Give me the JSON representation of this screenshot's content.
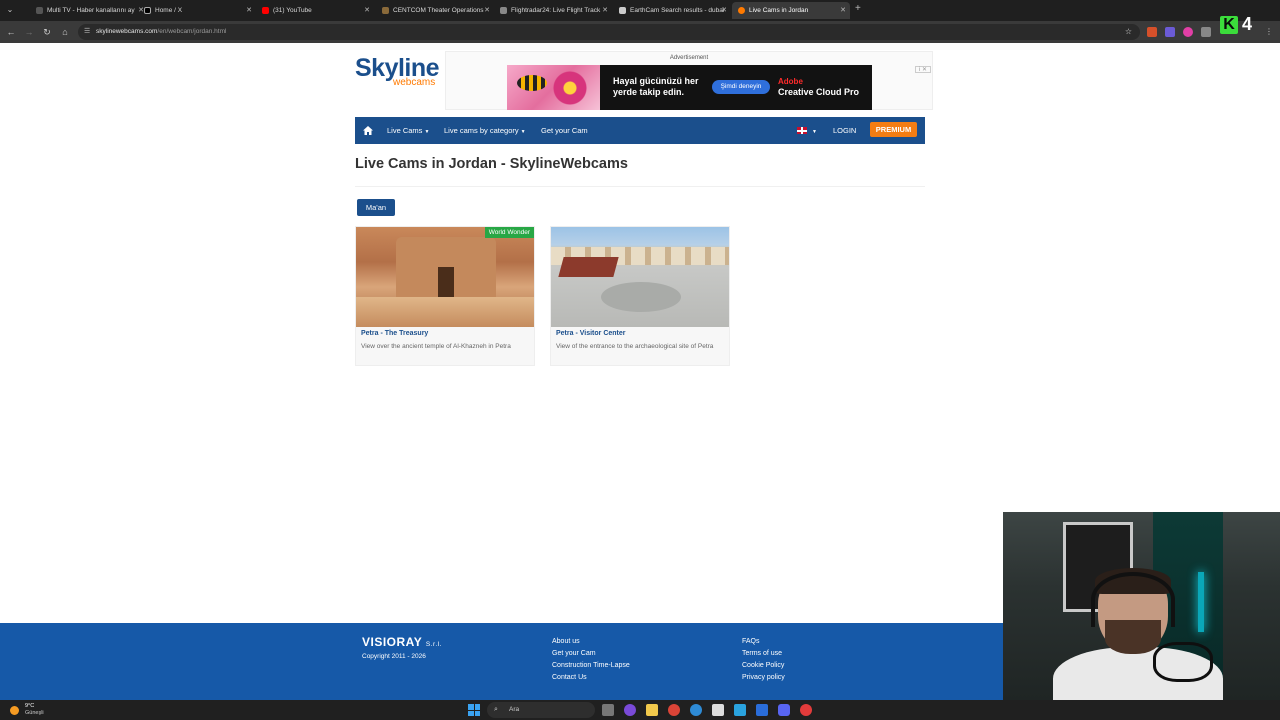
{
  "browser": {
    "tabs": [
      {
        "label": "Multi TV - Haber kanallarını ay",
        "color": "#555555"
      },
      {
        "label": "Home / X",
        "color": "#000000"
      },
      {
        "label": "(31) YouTube",
        "color": "#ff0000"
      },
      {
        "label": "CENTCOM Theater Operations",
        "color": "#8a6a3a"
      },
      {
        "label": "Flightradar24: Live Flight Track",
        "color": "#888888"
      },
      {
        "label": "EarthCam Search results - dubai",
        "color": "#cccccc"
      },
      {
        "label": "Live Cams in Jordan",
        "color": "#ff7a00"
      }
    ],
    "url_host": "skylinewebcams.com",
    "url_path": "/en/webcam/jordan.html",
    "overlay_channel_badge": {
      "letter": "K",
      "number": "4"
    }
  },
  "site": {
    "logo_main": "Skyline",
    "logo_sub": "webcams",
    "ad": {
      "label": "Advertisement",
      "headline": "Hayal gücünüzü her yerde takip edin.",
      "button": "Şimdi deneyin",
      "brand_line1": "Adobe",
      "brand_line2": "Creative Cloud Pro",
      "close": "i ✕"
    },
    "nav": {
      "live_cams": "Live Cams",
      "by_category": "Live cams by category",
      "get_your_cam": "Get your Cam",
      "login": "LOGIN",
      "premium": "PREMIUM"
    },
    "title": "Live Cams in Jordan - SkylineWebcams",
    "filter_button": "Ma'an",
    "cams": [
      {
        "badge": "World Wonder",
        "title": "Petra - The Treasury",
        "desc": "View over the ancient temple of Al-Khazneh in Petra"
      },
      {
        "badge": "",
        "title": "Petra - Visitor Center",
        "desc": "View of the entrance to the archaeological site of Petra"
      }
    ],
    "footer": {
      "brand": "VISIORAY",
      "brand_suffix": "S.r.l.",
      "copyright": "Copyright 2011 - 2026",
      "col1": [
        "About us",
        "Get your Cam",
        "Construction Time-Lapse",
        "Contact Us"
      ],
      "col2": [
        "FAQs",
        "Terms of use",
        "Cookie Policy",
        "Privacy policy"
      ]
    }
  },
  "taskbar": {
    "weather_temp": "9°C",
    "weather_desc": "Güneşli",
    "search_placeholder": "Ara"
  }
}
